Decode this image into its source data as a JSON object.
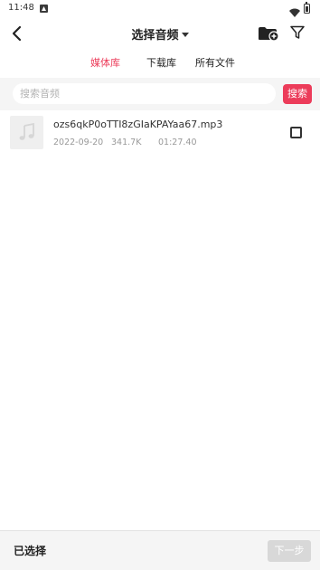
{
  "status_bar": {
    "time": "11:48"
  },
  "header": {
    "title": "选择音频",
    "icons": [
      "back-arrow-icon",
      "caret-down-icon",
      "folder-add-icon",
      "filter-icon"
    ]
  },
  "tabs": [
    {
      "label": "媒体库",
      "active": true
    },
    {
      "label": "下载库",
      "active": false
    },
    {
      "label": "所有文件",
      "active": false
    }
  ],
  "search": {
    "placeholder": "搜索音频",
    "value": "",
    "button_label": "搜索"
  },
  "files": [
    {
      "name": "ozs6qkP0oTTI8zGIaKPAYaa67.mp3",
      "date": "2022-09-20",
      "size": "341.7K",
      "duration": "01:27.40",
      "checked": false,
      "icon": "music-note-icon"
    }
  ],
  "bottom_bar": {
    "selected_label": "已选择",
    "next_label": "下一步",
    "next_enabled": false
  },
  "colors": {
    "accent": "#ec3c5a",
    "search_bg": "#f5f5f5",
    "disabled_button": "#d8d8d8"
  }
}
